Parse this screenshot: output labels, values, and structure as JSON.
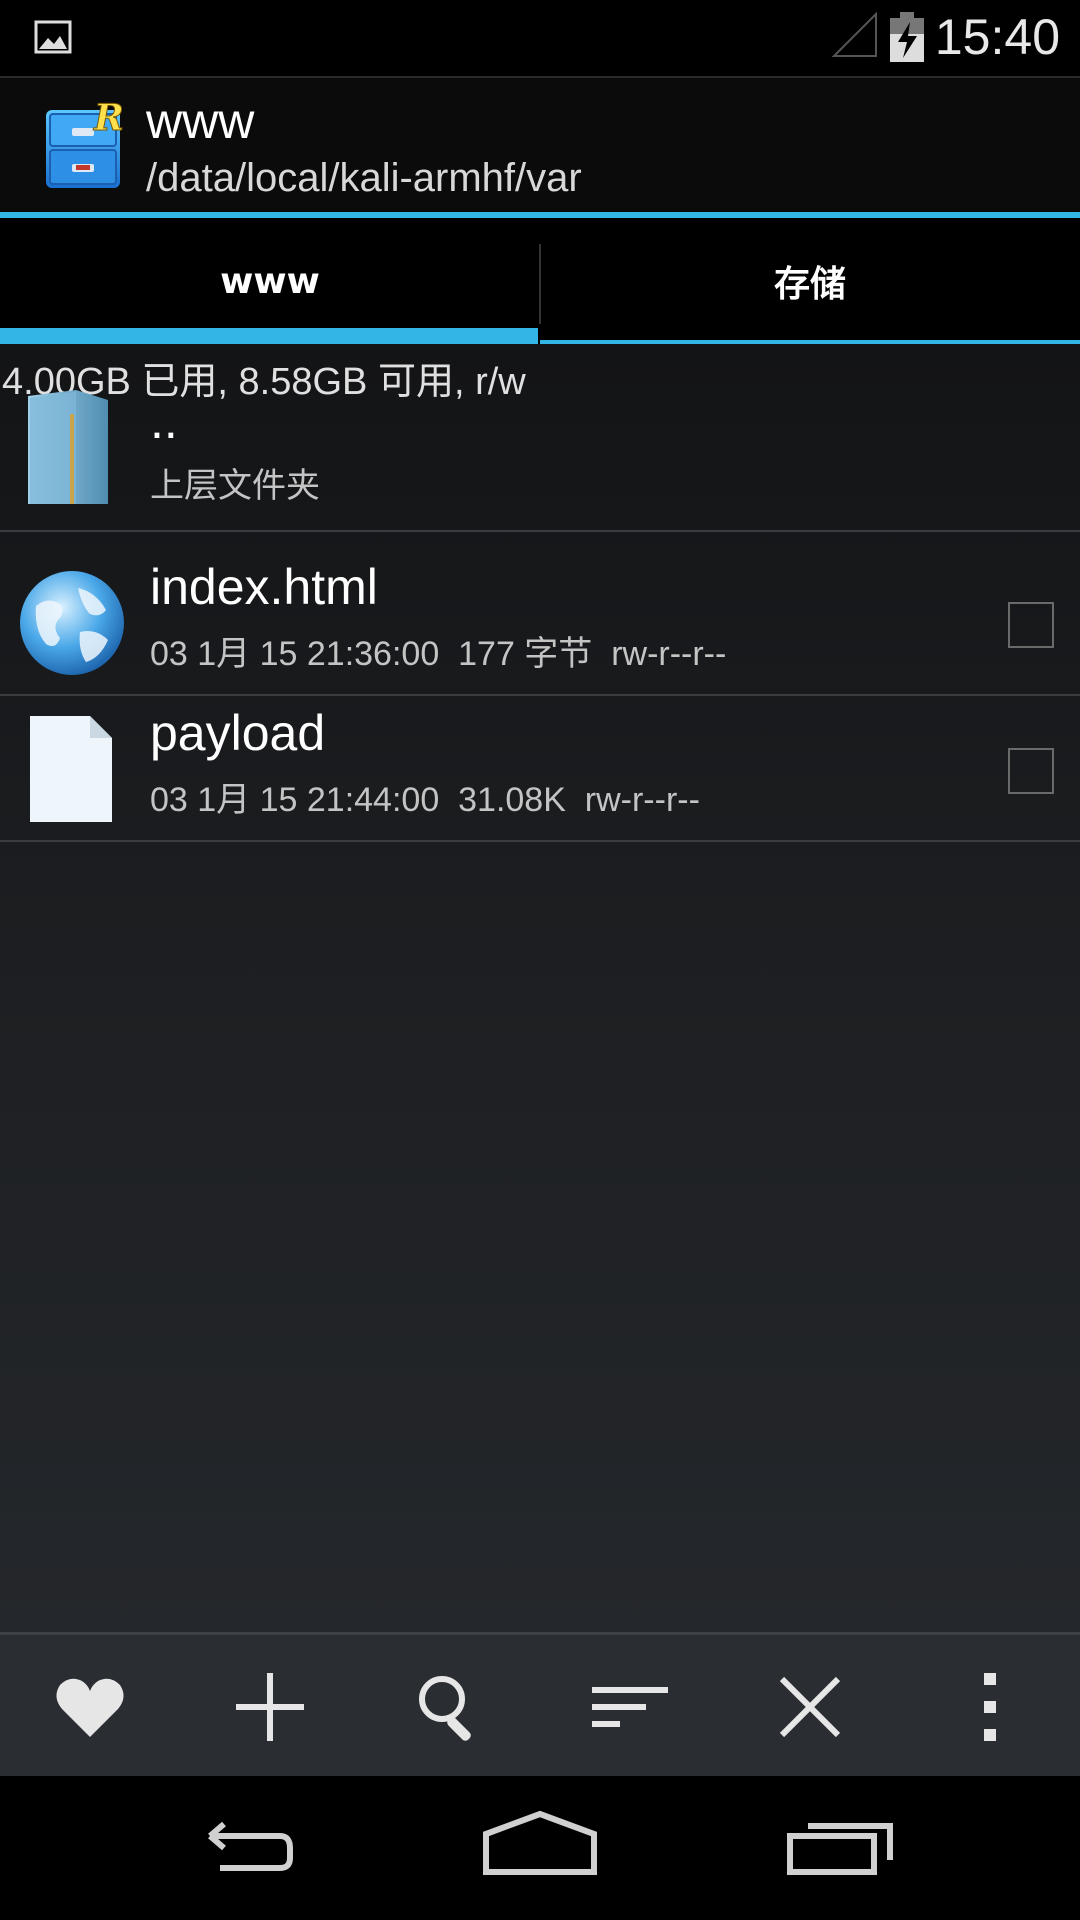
{
  "status_bar": {
    "time": "15:40"
  },
  "action_bar": {
    "title": "www",
    "subtitle": "/data/local/kali-armhf/var"
  },
  "tabs": [
    {
      "label": "www",
      "active": true
    },
    {
      "label": "存储",
      "active": false
    }
  ],
  "storage_info": "4.00GB 已用, 8.58GB 可用, r/w",
  "files": [
    {
      "name": "..",
      "meta": "上层文件夹",
      "icon": "folder-icon",
      "checkbox": false
    },
    {
      "name": "index.html",
      "meta": "03 1月 15 21:36:00  177 字节  rw-r--r--",
      "icon": "globe-icon",
      "checkbox": true
    },
    {
      "name": "payload",
      "meta": "03 1月 15 21:44:00  31.08K  rw-r--r--",
      "icon": "document-icon",
      "checkbox": true
    }
  ],
  "bottom_actions": [
    "heart-icon",
    "plus-icon",
    "search-icon",
    "sort-icon",
    "close-icon",
    "overflow-menu-icon"
  ],
  "nav_buttons": [
    "back-icon",
    "home-icon",
    "recents-icon"
  ],
  "colors": {
    "accent": "#33b5e5",
    "bottom_bar": "#2a2d31"
  }
}
